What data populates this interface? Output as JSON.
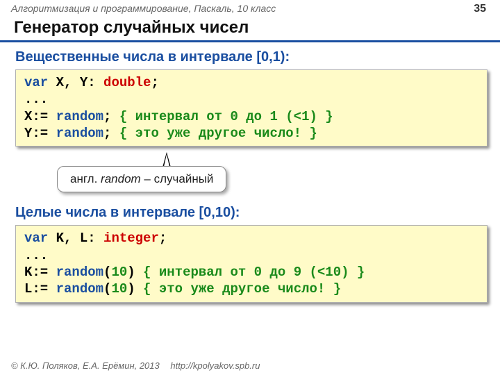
{
  "header": {
    "course": "Алгоритмизация и программирование, Паскаль, 10 класс",
    "page": "35"
  },
  "title": "Генератор случайных чисел",
  "sec1": {
    "heading": "Вещественные числа в интервале [0,1):",
    "code": {
      "l1a": "var",
      "l1b": " X, Y: ",
      "l1c": "double",
      "l1d": ";",
      "l2": "...",
      "l3a": "X:= ",
      "l3b": "random",
      "l3c": ";",
      "l3d": " { интервал от 0 до 1 (<1) }",
      "l4a": "Y:= ",
      "l4b": "random",
      "l4c": ";",
      "l4d": " { это уже другое число! }"
    }
  },
  "callout": {
    "prefix": "англ. ",
    "word": "random",
    "suffix": " – случайный"
  },
  "sec2": {
    "heading": "Целые числа в интервале [0,10):",
    "code": {
      "l1a": "var",
      "l1b": " K, L: ",
      "l1c": "integer",
      "l1d": ";",
      "l2": "...",
      "l3a": "K:= ",
      "l3b": "random",
      "l3c": "(",
      "l3d": "10",
      "l3e": ")",
      "l3f": " { интервал от 0 до 9 (<10) }",
      "l4a": "L:= ",
      "l4b": "random",
      "l4c": "(",
      "l4d": "10",
      "l4e": ")",
      "l4f": " { это уже другое число! }"
    }
  },
  "footer": {
    "copyright": "© К.Ю. Поляков, Е.А. Ерёмин, 2013",
    "url": "http://kpolyakov.spb.ru"
  }
}
